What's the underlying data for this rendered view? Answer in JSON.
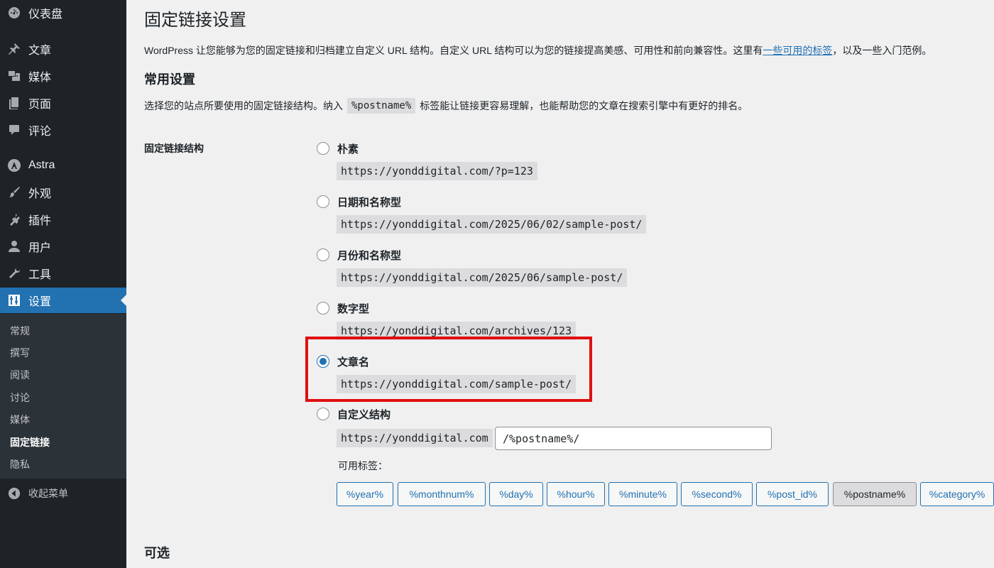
{
  "sidebar": {
    "items": [
      {
        "label": "仪表盘",
        "icon": "dashboard-icon"
      },
      {
        "label": "文章",
        "icon": "pin-icon"
      },
      {
        "label": "媒体",
        "icon": "media-icon"
      },
      {
        "label": "页面",
        "icon": "page-icon"
      },
      {
        "label": "评论",
        "icon": "comment-icon"
      },
      {
        "label": "Astra",
        "icon": "astra-icon"
      },
      {
        "label": "外观",
        "icon": "brush-icon"
      },
      {
        "label": "插件",
        "icon": "plugin-icon"
      },
      {
        "label": "用户",
        "icon": "user-icon"
      },
      {
        "label": "工具",
        "icon": "wrench-icon"
      },
      {
        "label": "设置",
        "icon": "settings-icon"
      }
    ],
    "submenu": [
      "常规",
      "撰写",
      "阅读",
      "讨论",
      "媒体",
      "固定链接",
      "隐私"
    ],
    "collapse_label": "收起菜单"
  },
  "main": {
    "title": "固定链接设置",
    "intro_before": "WordPress 让您能够为您的固定链接和归档建立自定义 URL 结构。自定义 URL 结构可以为您的链接提高美感、可用性和前向兼容性。这里有",
    "intro_link": "一些可用的标签",
    "intro_after": "，以及一些入门范例。",
    "common_heading": "常用设置",
    "desc_before": "选择您的站点所要使用的固定链接结构。纳入",
    "desc_code": "%postname%",
    "desc_after": "标签能让链接更容易理解，也能帮助您的文章在搜索引擎中有更好的排名。",
    "structure_label": "固定链接结构",
    "options": [
      {
        "label": "朴素",
        "example": "https://yonddigital.com/?p=123",
        "checked": false
      },
      {
        "label": "日期和名称型",
        "example": "https://yonddigital.com/2025/06/02/sample-post/",
        "checked": false
      },
      {
        "label": "月份和名称型",
        "example": "https://yonddigital.com/2025/06/sample-post/",
        "checked": false
      },
      {
        "label": "数字型",
        "example": "https://yonddigital.com/archives/123",
        "checked": false
      },
      {
        "label": "文章名",
        "example": "https://yonddigital.com/sample-post/",
        "checked": true
      },
      {
        "label": "自定义结构",
        "checked": false
      }
    ],
    "custom": {
      "base": "https://yonddigital.com",
      "value": "/%postname%/",
      "tags_label": "可用标签：",
      "tags": [
        "%year%",
        "%monthnum%",
        "%day%",
        "%hour%",
        "%minute%",
        "%second%",
        "%post_id%",
        "%postname%",
        "%category%"
      ],
      "active_tag": "%postname%"
    },
    "optional_heading": "可选"
  },
  "colors": {
    "sidebar_bg": "#1d2327",
    "accent": "#2271b1",
    "highlight_box": "#e01010"
  }
}
